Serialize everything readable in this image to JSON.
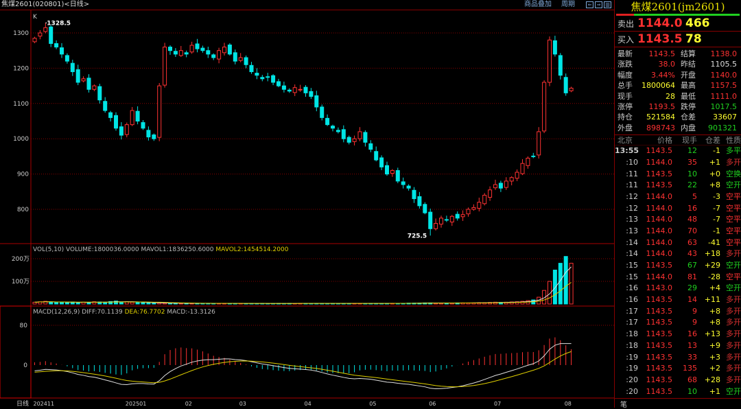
{
  "header": {
    "title": "焦煤2601(020801)<日线>",
    "overlay_label": "商品叠加",
    "period_label": "周期"
  },
  "price_axis": [
    "1300",
    "1200",
    "1100",
    "1000",
    "900",
    "800"
  ],
  "price_axis_values": [
    1300,
    1200,
    1100,
    1000,
    900,
    800
  ],
  "k_label": "K",
  "high_annotation": "1328.5",
  "low_annotation": "725.5",
  "vol": {
    "header_a": "VOL(5,10) VOLUME:1800036.0000 MAVOL1:1836250.6000",
    "header_b": "MAVOL2:1454514.2000",
    "axis": [
      "200万",
      "100万"
    ],
    "axis_values": [
      200,
      100
    ]
  },
  "macd": {
    "header_a": "MACD(12,26,9) DIFF:70.1139",
    "header_b": "DEA:76.7702",
    "header_c": "MACD:-13.3126",
    "axis": [
      "80",
      "0"
    ],
    "axis_values": [
      80,
      0
    ]
  },
  "date_axis": {
    "label": "日线",
    "ticks": [
      {
        "t": "202411",
        "i": 0
      },
      {
        "t": "202501",
        "i": 17
      },
      {
        "t": "02",
        "i": 28
      },
      {
        "t": "03",
        "i": 38
      },
      {
        "t": "04",
        "i": 50
      },
      {
        "t": "05",
        "i": 62
      },
      {
        "t": "06",
        "i": 73
      },
      {
        "t": "07",
        "i": 85
      },
      {
        "t": "08",
        "i": 98
      }
    ]
  },
  "colors": {
    "up": "#ff3232",
    "down": "#00e5e5",
    "grid": "#8a0000",
    "white_line": "#e0e0e0",
    "yellow_line": "#e0d000"
  },
  "chart_data": {
    "type": "candlestick",
    "close": [
      1285,
      1300,
      1315,
      1270,
      1260,
      1240,
      1220,
      1190,
      1160,
      1170,
      1140,
      1150,
      1110,
      1080,
      1060,
      1030,
      1010,
      1040,
      1080,
      1050,
      1030,
      1005,
      1000,
      1150,
      1260,
      1250,
      1240,
      1250,
      1240,
      1265,
      1255,
      1250,
      1240,
      1230,
      1250,
      1260,
      1240,
      1220,
      1230,
      1210,
      1190,
      1180,
      1170,
      1175,
      1160,
      1150,
      1140,
      1135,
      1145,
      1140,
      1130,
      1120,
      1090,
      1060,
      1040,
      1030,
      1020,
      1000,
      990,
      1000,
      1020,
      990,
      970,
      940,
      920,
      900,
      910,
      880,
      870,
      860,
      830,
      810,
      790,
      745,
      760,
      775,
      770,
      780,
      775,
      785,
      800,
      805,
      820,
      840,
      855,
      870,
      860,
      880,
      890,
      905,
      930,
      945,
      950,
      1020,
      1160,
      1280,
      1240,
      1180,
      1130,
      1143.5
    ],
    "volume_wan": [
      8,
      10,
      12,
      9,
      7,
      8,
      6,
      9,
      7,
      8,
      6,
      10,
      9,
      8,
      11,
      13,
      9,
      10,
      8,
      7,
      6,
      5,
      4,
      5,
      4,
      3,
      3,
      3,
      4,
      3,
      3,
      3,
      2,
      3,
      3,
      2,
      3,
      2,
      3,
      2,
      3,
      2,
      3,
      2,
      2,
      3,
      2,
      3,
      2,
      3,
      3,
      2,
      3,
      3,
      2,
      3,
      3,
      2,
      3,
      3,
      3,
      2,
      3,
      3,
      3,
      3,
      3,
      3,
      3,
      4,
      4,
      4,
      5,
      5,
      4,
      4,
      4,
      4,
      5,
      5,
      5,
      5,
      6,
      6,
      7,
      8,
      7,
      8,
      9,
      10,
      12,
      15,
      18,
      30,
      60,
      100,
      150,
      180,
      210,
      180
    ],
    "high_index": 2,
    "high_value": 1328.5,
    "low_index": 73,
    "low_value": 725.5
  },
  "quote": {
    "title": "焦煤2601(jm2601)",
    "sell_label": "卖出",
    "sell_price": "1144.0",
    "sell_vol": "466",
    "buy_label": "买入",
    "buy_price": "1143.5",
    "buy_vol": "78",
    "stats": [
      {
        "l": "最新",
        "v": "1143.5",
        "c": "up",
        "l2": "结算",
        "v2": "1138.0",
        "c2": "up"
      },
      {
        "l": "涨跌",
        "v": "38.0",
        "c": "up",
        "l2": "昨结",
        "v2": "1105.5",
        "c2": "wh"
      },
      {
        "l": "幅度",
        "v": "3.44%",
        "c": "up",
        "l2": "开盘",
        "v2": "1140.0",
        "c2": "up"
      },
      {
        "l": "总手",
        "v": "1800064",
        "c": "yl",
        "l2": "最高",
        "v2": "1157.5",
        "c2": "up"
      },
      {
        "l": "现手",
        "v": "28",
        "c": "yl",
        "l2": "最低",
        "v2": "1111.0",
        "c2": "up"
      },
      {
        "l": "涨停",
        "v": "1193.5",
        "c": "up",
        "l2": "跌停",
        "v2": "1017.5",
        "c2": "dn"
      },
      {
        "l": "持仓",
        "v": "521584",
        "c": "yl",
        "l2": "仓差",
        "v2": "33607",
        "c2": "yl"
      },
      {
        "l": "外盘",
        "v": "898743",
        "c": "up",
        "l2": "内盘",
        "v2": "901321",
        "c2": "dn"
      }
    ],
    "tick_headers": [
      "北京",
      "价格",
      "现手",
      "仓差",
      "性质"
    ],
    "ticks": [
      {
        "t": "13:55",
        "p": "1143.5",
        "v": "12",
        "d": "-1",
        "n": "多平",
        "s": "dn"
      },
      {
        "t": ":10",
        "p": "1144.0",
        "v": "35",
        "d": "+1",
        "n": "多开",
        "s": "up"
      },
      {
        "t": ":11",
        "p": "1143.5",
        "v": "10",
        "d": "+0",
        "n": "空换",
        "s": "dn"
      },
      {
        "t": ":11",
        "p": "1143.5",
        "v": "22",
        "d": "+8",
        "n": "空开",
        "s": "dn"
      },
      {
        "t": ":12",
        "p": "1144.0",
        "v": "5",
        "d": "-3",
        "n": "空平",
        "s": "up"
      },
      {
        "t": ":12",
        "p": "1144.0",
        "v": "16",
        "d": "-7",
        "n": "空平",
        "s": "up"
      },
      {
        "t": ":13",
        "p": "1144.0",
        "v": "48",
        "d": "-7",
        "n": "空平",
        "s": "up"
      },
      {
        "t": ":13",
        "p": "1144.0",
        "v": "70",
        "d": "-1",
        "n": "空平",
        "s": "up"
      },
      {
        "t": ":14",
        "p": "1144.0",
        "v": "63",
        "d": "-41",
        "n": "空平",
        "s": "up"
      },
      {
        "t": ":14",
        "p": "1144.0",
        "v": "43",
        "d": "+18",
        "n": "多开",
        "s": "up"
      },
      {
        "t": ":15",
        "p": "1143.5",
        "v": "67",
        "d": "+29",
        "n": "空开",
        "s": "dn"
      },
      {
        "t": ":15",
        "p": "1144.0",
        "v": "81",
        "d": "-28",
        "n": "空平",
        "s": "up"
      },
      {
        "t": ":16",
        "p": "1143.0",
        "v": "29",
        "d": "+4",
        "n": "空开",
        "s": "dn"
      },
      {
        "t": ":16",
        "p": "1143.5",
        "v": "14",
        "d": "+11",
        "n": "多开",
        "s": "up"
      },
      {
        "t": ":17",
        "p": "1143.5",
        "v": "9",
        "d": "+8",
        "n": "多开",
        "s": "up"
      },
      {
        "t": ":17",
        "p": "1143.5",
        "v": "9",
        "d": "+8",
        "n": "多开",
        "s": "up"
      },
      {
        "t": ":18",
        "p": "1143.5",
        "v": "16",
        "d": "+13",
        "n": "多开",
        "s": "up"
      },
      {
        "t": ":18",
        "p": "1143.5",
        "v": "13",
        "d": "+9",
        "n": "多开",
        "s": "up"
      },
      {
        "t": ":19",
        "p": "1143.5",
        "v": "33",
        "d": "+3",
        "n": "多开",
        "s": "up"
      },
      {
        "t": ":19",
        "p": "1143.5",
        "v": "135",
        "d": "+2",
        "n": "多开",
        "s": "up"
      },
      {
        "t": ":20",
        "p": "1143.5",
        "v": "68",
        "d": "+28",
        "n": "多开",
        "s": "up"
      },
      {
        "t": ":20",
        "p": "1143.5",
        "v": "10",
        "d": "+1",
        "n": "空开",
        "s": "dn"
      }
    ],
    "footer_tab": "笔"
  }
}
